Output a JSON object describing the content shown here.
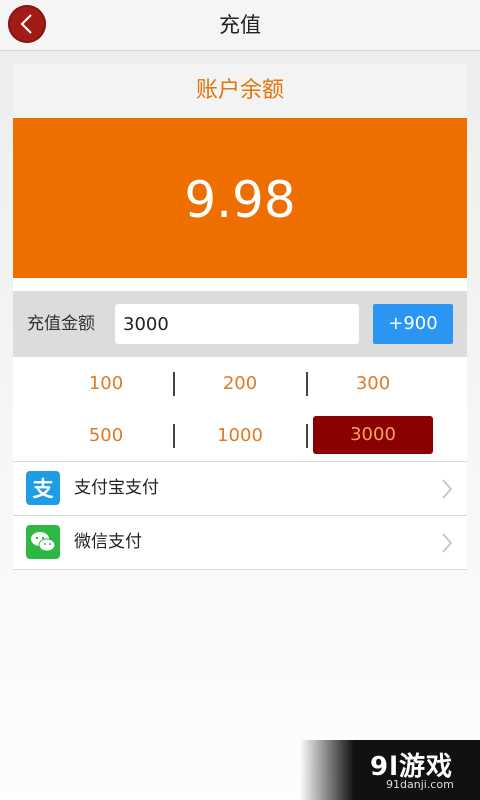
{
  "header": {
    "title": "充值"
  },
  "balance": {
    "label": "账户余额",
    "value": "9.98"
  },
  "amount": {
    "label": "充值金额",
    "value": "3000",
    "plus_label": "+900"
  },
  "quick_amounts": {
    "selected": "3000",
    "items": [
      "100",
      "200",
      "300",
      "500",
      "1000",
      "3000"
    ]
  },
  "payments": [
    {
      "label": "支付宝支付",
      "icon": "alipay-icon"
    },
    {
      "label": "微信支付",
      "icon": "wechat-icon"
    }
  ],
  "watermark": {
    "logo": "9l游戏",
    "site": "91danji.com"
  },
  "colors": {
    "accent_orange": "#ee6e00",
    "selected_red": "#8b0000",
    "button_blue": "#2a95f3"
  }
}
